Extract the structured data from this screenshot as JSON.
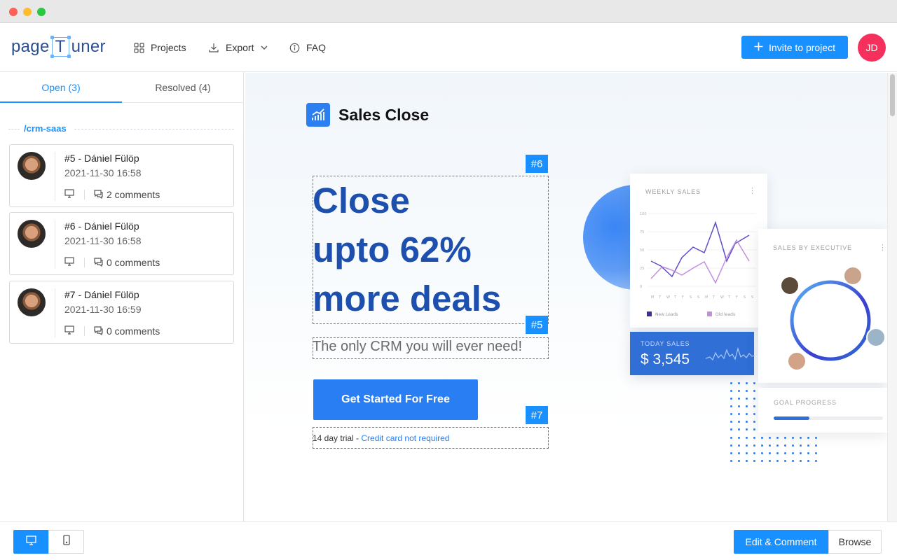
{
  "window": {
    "traffic_lights": [
      "#fe5f57",
      "#febc2e",
      "#28c840"
    ]
  },
  "header": {
    "logo": {
      "prefix": "page",
      "boxed": "T",
      "suffix": "uner"
    },
    "nav": [
      {
        "label": "Projects",
        "icon": "grid-icon"
      },
      {
        "label": "Export",
        "icon": "download-icon",
        "dropdown": true
      },
      {
        "label": "FAQ",
        "icon": "info-circle-icon"
      }
    ],
    "invite_button": "Invite to project",
    "user_initials": "JD"
  },
  "sidebar": {
    "tabs": [
      {
        "label": "Open (3)",
        "active": true
      },
      {
        "label": "Resolved (4)",
        "active": false
      }
    ],
    "group": "/crm-saas",
    "items": [
      {
        "title": "#5 - Dániel Fülöp",
        "date": "2021-11-30 16:58",
        "comments": "2 comments"
      },
      {
        "title": "#6 - Dániel Fülöp",
        "date": "2021-11-30 16:58",
        "comments": "0 comments"
      },
      {
        "title": "#7 - Dániel Fülöp",
        "date": "2021-11-30 16:59",
        "comments": "0 comments"
      }
    ]
  },
  "preview": {
    "brand": "Sales Close",
    "headline": [
      "Close",
      "upto 62%",
      "more deals"
    ],
    "subheading": "The only CRM you will ever need!",
    "cta": "Get Started For Free",
    "trial": {
      "text": "14 day trial - ",
      "link": "Credit card not required"
    },
    "pins": [
      "#6",
      "#5",
      "#7"
    ],
    "dashboard": {
      "weekly_sales": "WEEKLY SALES",
      "y_ticks": [
        "100",
        "75",
        "50",
        "25",
        "0"
      ],
      "x_ticks": [
        "M",
        "T",
        "W",
        "T",
        "F",
        "S",
        "S",
        "M",
        "T",
        "W",
        "T",
        "F",
        "S",
        "S"
      ],
      "legend": [
        "New Leads",
        "Old leads"
      ],
      "today_sales_label": "TODAY SALES",
      "today_sales_value": "$ 3,545",
      "sales_by_executive": "SALES BY EXECUTIVE",
      "goal_progress": "GOAL PROGRESS",
      "goal_progress_value": 0.33
    }
  },
  "bottombar": {
    "device_modes": [
      "desktop-icon",
      "mobile-icon"
    ],
    "edit_comment": "Edit & Comment",
    "browse": "Browse"
  },
  "colors": {
    "accent": "#1890ff",
    "headline": "#1d4fae",
    "avatar": "#f5305c"
  }
}
